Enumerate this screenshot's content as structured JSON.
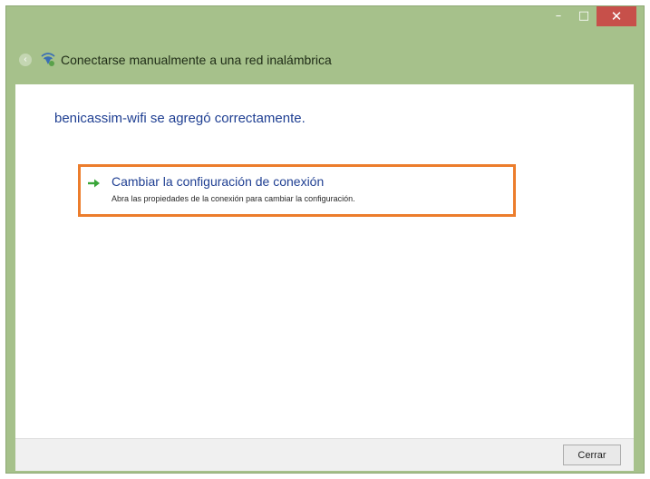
{
  "window": {
    "title": "Conectarse manualmente a una red inalámbrica",
    "controls": {
      "minimize": "–",
      "maximize": "□",
      "close": "✕"
    },
    "back_glyph": "‹",
    "frame_color": "#a6c18b",
    "close_color": "#c7504a"
  },
  "content": {
    "heading": "benicassim-wifi se agregó correctamente.",
    "option": {
      "title": "Cambiar la configuración de conexión",
      "description": "Abra las propiedades de la conexión para cambiar la configuración.",
      "icon": "green-arrow-icon",
      "highlight_color": "#ec7d2c"
    }
  },
  "footer": {
    "close_button": "Cerrar"
  }
}
